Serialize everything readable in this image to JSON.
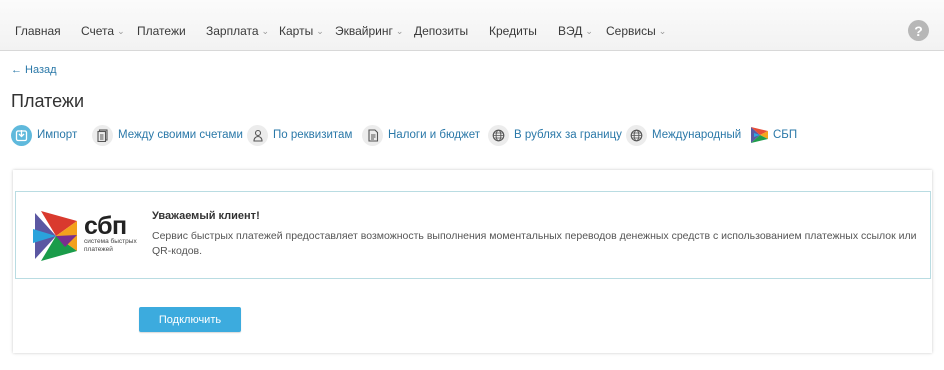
{
  "nav": {
    "items": [
      {
        "label": "Главная",
        "dropdown": false
      },
      {
        "label": "Счета",
        "dropdown": true
      },
      {
        "label": "Платежи",
        "dropdown": false
      },
      {
        "label": "Зарплата",
        "dropdown": true
      },
      {
        "label": "Карты",
        "dropdown": true
      },
      {
        "label": "Эквайринг",
        "dropdown": true
      },
      {
        "label": "Депозиты",
        "dropdown": false
      },
      {
        "label": "Кредиты",
        "dropdown": false
      },
      {
        "label": "ВЭД",
        "dropdown": true
      },
      {
        "label": "Сервисы",
        "dropdown": true
      }
    ],
    "help_label": "?"
  },
  "back_link": "← Назад",
  "page_title": "Платежи",
  "payment_tabs": [
    {
      "label": "Импорт",
      "icon": "import-icon",
      "active": true
    },
    {
      "label": "Между своими счетами",
      "icon": "document-icon"
    },
    {
      "label": "По реквизитам",
      "icon": "person-icon"
    },
    {
      "label": "Налоги и бюджет",
      "icon": "tax-document-icon"
    },
    {
      "label": "В рублях за границу",
      "icon": "globe-icon"
    },
    {
      "label": "Международный",
      "icon": "globe-icon"
    },
    {
      "label": "СБП",
      "icon": "sbp-logo-icon"
    }
  ],
  "notice": {
    "logo_title": "сбп",
    "logo_subtitle": "система быстрых платежей",
    "title": "Уважаемый клиент!",
    "text": "Сервис быстрых платежей предоставляет возможность выполнения моментальных переводов денежных средств с использованием платежных ссылок или QR-кодов."
  },
  "connect_button": "Подключить",
  "colors": {
    "link": "#2a78a8",
    "accent_button": "#3cabde",
    "active_tab_icon": "#5fb9dc",
    "notice_border": "#b9dce2"
  }
}
